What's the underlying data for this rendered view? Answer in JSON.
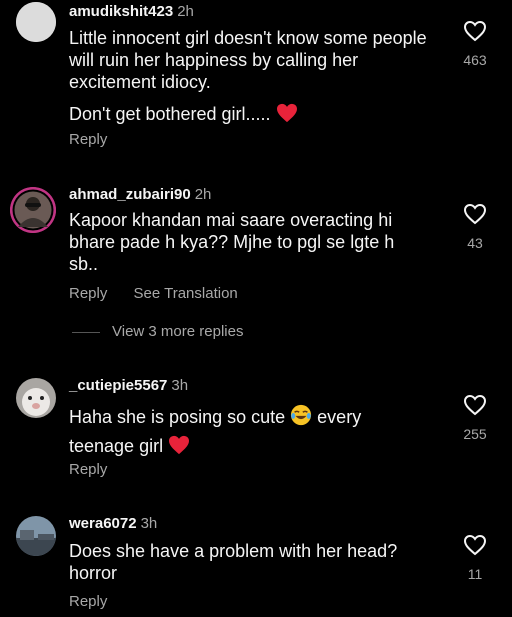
{
  "comments": [
    {
      "username": "amudikshit423",
      "time": "2h",
      "text_line1": "Little innocent girl doesn't know some people will ruin her happiness by calling her excitement idiocy.",
      "text_line2": "Don't get bothered girl.....",
      "likes": "463",
      "reply_label": "Reply"
    },
    {
      "username": "ahmad_zubairi90",
      "time": "2h",
      "text": "Kapoor khandan mai saare overacting hi bhare pade h kya?? Mjhe to pgl se lgte h sb..",
      "likes": "43",
      "reply_label": "Reply",
      "translation_label": "See Translation"
    },
    {
      "username": "_cutiepie5567",
      "time": "3h",
      "text_part1": "Haha she is posing so cute",
      "text_part2": "every teenage girl",
      "likes": "255",
      "reply_label": "Reply"
    },
    {
      "username": "wera6072",
      "time": "3h",
      "text": "Does she have a problem with her head? horror",
      "likes": "11",
      "reply_label": "Reply"
    }
  ],
  "view_more_replies": "View 3 more replies",
  "icons": {
    "like": "heart-outline-icon",
    "emoji_heart": "red-heart-emoji",
    "emoji_laugh": "tears-of-joy-emoji"
  },
  "colors": {
    "background": "#000000",
    "text": "#f5f5f5",
    "secondary": "#a8a8a8",
    "heart": "#e8233a",
    "story_ring": "#c13584"
  }
}
